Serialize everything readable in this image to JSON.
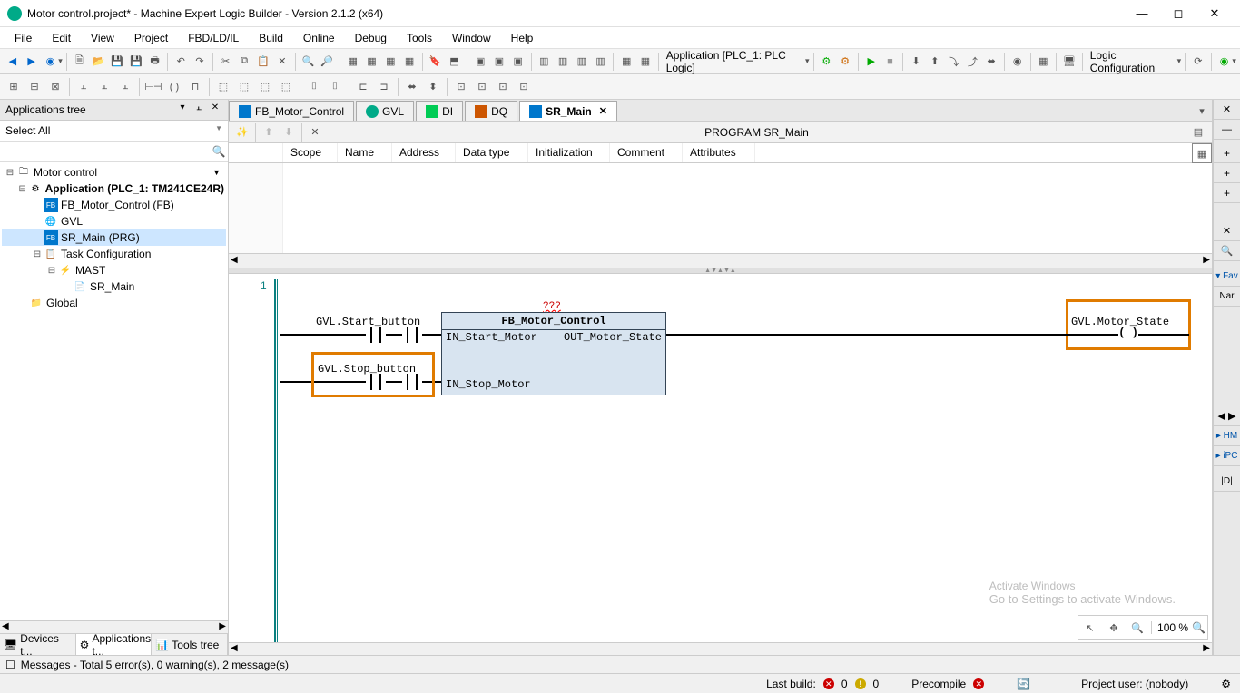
{
  "window": {
    "title": "Motor control.project* - Machine Expert Logic Builder - Version 2.1.2 (x64)"
  },
  "menu": [
    "File",
    "Edit",
    "View",
    "Project",
    "FBD/LD/IL",
    "Build",
    "Online",
    "Debug",
    "Tools",
    "Window",
    "Help"
  ],
  "toolbar2_app": "Application [PLC_1: PLC Logic]",
  "toolbar2_config": "Logic Configuration",
  "left_panel": {
    "title": "Applications tree",
    "select_all": "Select All",
    "tree": {
      "root": "Motor control",
      "app": "Application (PLC_1: TM241CE24R)",
      "fb": "FB_Motor_Control (FB)",
      "gvl": "GVL",
      "sr": "SR_Main (PRG)",
      "task_cfg": "Task Configuration",
      "mast": "MAST",
      "sr_task": "SR_Main",
      "global": "Global"
    },
    "tabs": {
      "devices": "Devices t...",
      "apps": "Applications t...",
      "tools": "Tools tree"
    }
  },
  "editor_tabs": [
    {
      "label": "FB_Motor_Control",
      "icon": "fb"
    },
    {
      "label": "GVL",
      "icon": "gvl"
    },
    {
      "label": "DI",
      "icon": "io"
    },
    {
      "label": "DQ",
      "icon": "io"
    },
    {
      "label": "SR_Main",
      "icon": "fb",
      "active": true
    }
  ],
  "program_title": "PROGRAM SR_Main",
  "decl_cols": [
    "Scope",
    "Name",
    "Address",
    "Data type",
    "Initialization",
    "Comment",
    "Attributes"
  ],
  "ladder": {
    "rung_num": "1",
    "start_btn": "GVL.Start_button",
    "stop_btn": "GVL.Stop_button",
    "fb_name": "FB_Motor_Control",
    "fb_inst_err": "???",
    "in1": "IN_Start_Motor",
    "in2": "IN_Stop_Motor",
    "out1": "OUT_Motor_State",
    "coil_var": "GVL.Motor_State"
  },
  "zoom": "100 %",
  "right_panel": {
    "fav": "▾ Fav",
    "nar": "Nar",
    "hm": "▸ HM",
    "ipc": "▸ iPC",
    "d": "|D|"
  },
  "status1": "Messages - Total 5 error(s), 0 warning(s), 2 message(s)",
  "status2": {
    "lastbuild": "Last build:",
    "e": "0",
    "w": "0",
    "precompile": "Precompile",
    "user": "Project user: (nobody)"
  },
  "watermark": {
    "line1": "Activate Windows",
    "line2": "Go to Settings to activate Windows."
  }
}
